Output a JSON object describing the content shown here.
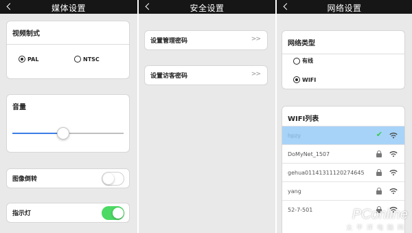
{
  "media": {
    "title": "媒体设置",
    "video_format": {
      "label": "视频制式",
      "options": [
        "PAL",
        "NTSC"
      ],
      "selected": "PAL"
    },
    "volume": {
      "label": "音量",
      "level": 0.45
    },
    "flip": {
      "label": "图像倒转",
      "on": false
    },
    "indicator": {
      "label": "指示灯",
      "on": true
    }
  },
  "security": {
    "title": "安全设置",
    "items": [
      {
        "label": "设置管理密码",
        "chevron": ">>"
      },
      {
        "label": "设置访客密码",
        "chevron": ">>"
      }
    ]
  },
  "network": {
    "title": "网络设置",
    "type_label": "网络类型",
    "options": [
      "有线",
      "WIFI"
    ],
    "selected": "WIFI",
    "wifi_list_label": "WIFI列表",
    "wifi_list": [
      {
        "name": "hpzy",
        "selected": true,
        "locked": false
      },
      {
        "name": "DoMyNet_1507",
        "selected": false,
        "locked": true
      },
      {
        "name": "gehua01141311120274645",
        "selected": false,
        "locked": true
      },
      {
        "name": "yang",
        "selected": false,
        "locked": true
      },
      {
        "name": "52-7-501",
        "selected": false,
        "locked": true
      }
    ],
    "check_mark": "✔"
  },
  "watermark": {
    "brand": "PConline",
    "sub": "太平洋电脑网"
  },
  "colors": {
    "navbar": "#161616",
    "toggle_on": "#4cd964",
    "slider": "#3d7ee5",
    "selected_row": "#a8d3f8"
  }
}
